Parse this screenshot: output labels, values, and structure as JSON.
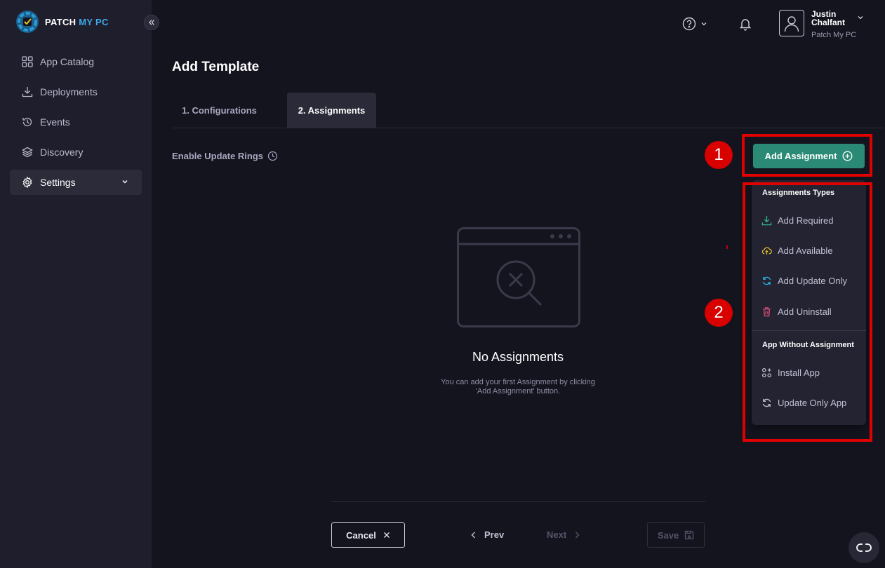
{
  "brand": {
    "name_part1": "PATCH ",
    "name_part2": "MY PC"
  },
  "sidebar": {
    "items": [
      {
        "label": "App Catalog",
        "icon": "grid-icon"
      },
      {
        "label": "Deployments",
        "icon": "download-icon"
      },
      {
        "label": "Events",
        "icon": "history-icon"
      },
      {
        "label": "Discovery",
        "icon": "layers-icon"
      },
      {
        "label": "Settings",
        "icon": "gear-icon",
        "active": true
      }
    ]
  },
  "header": {
    "user_first": "Justin",
    "user_last": "Chalfant",
    "org": "Patch My PC"
  },
  "main": {
    "title": "Add Template",
    "tabs": [
      {
        "label": "1. Configurations",
        "active": false
      },
      {
        "label": "2. Assignments",
        "active": true
      }
    ],
    "rings_label": "Enable Update Rings",
    "add_button": "Add Assignment",
    "empty_title": "No Assignments",
    "empty_desc": "You can add your first Assignment by clicking 'Add Assignment' button."
  },
  "dropdown": {
    "section1": "Assignments Types",
    "items1": [
      {
        "label": "Add Required",
        "icon": "download-icon",
        "color": "#2fbf8f"
      },
      {
        "label": "Add Available",
        "icon": "cloud-upload-icon",
        "color": "#e8c32a"
      },
      {
        "label": "Add Update Only",
        "icon": "refresh-icon",
        "color": "#2bb3e0"
      },
      {
        "label": "Add Uninstall",
        "icon": "trash-icon",
        "color": "#e0507a"
      }
    ],
    "section2": "App Without Assignment",
    "items2": [
      {
        "label": "Install App",
        "icon": "apps-add-icon"
      },
      {
        "label": "Update Only App",
        "icon": "refresh-icon"
      }
    ]
  },
  "annotations": {
    "badge1": "1",
    "badge2": "2"
  },
  "footer": {
    "cancel": "Cancel",
    "prev": "Prev",
    "next": "Next",
    "save": "Save"
  },
  "colors": {
    "accent": "#2a8a75",
    "highlight": "#e00000",
    "background": "#14141f",
    "sidebar": "#1e1e2c"
  }
}
